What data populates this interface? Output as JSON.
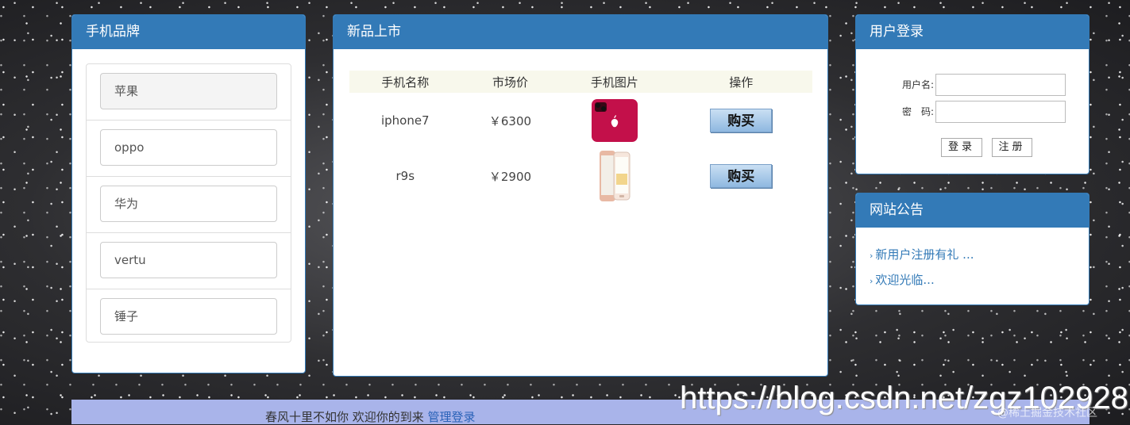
{
  "brands": {
    "title": "手机品牌",
    "items": [
      {
        "label": "苹果",
        "active": true
      },
      {
        "label": "oppo",
        "active": false
      },
      {
        "label": "华为",
        "active": false
      },
      {
        "label": "vertu",
        "active": false
      },
      {
        "label": "锤子",
        "active": false
      }
    ]
  },
  "products": {
    "title": "新品上市",
    "columns": [
      "手机名称",
      "市场价",
      "手机图片",
      "操作"
    ],
    "rows": [
      {
        "name": "iphone7",
        "price": "￥6300",
        "buy_label": "购买",
        "image_icon": "red-iphone"
      },
      {
        "name": "r9s",
        "price": "￥2900",
        "buy_label": "购买",
        "image_icon": "rose-gold-oppo-phone"
      }
    ]
  },
  "login": {
    "title": "用户登录",
    "username_label": "用户名:",
    "password_label": "密　码:",
    "username_value": "",
    "password_value": "",
    "login_button": "登录",
    "register_button": "注册"
  },
  "notice": {
    "title": "网站公告",
    "items": [
      "新用户注册有礼 ...",
      "欢迎光临..."
    ]
  },
  "footer": {
    "text": "春风十里不如你 欢迎你的到来 ",
    "admin_link": "管理登录"
  },
  "watermark": {
    "url": "https://blog.csdn.net/zgz102928",
    "site": "@稀土掘金技术社区"
  },
  "colors": {
    "panel_heading": "#337ab7",
    "footer_bg": "#a9b4ea",
    "link": "#337ab7"
  }
}
